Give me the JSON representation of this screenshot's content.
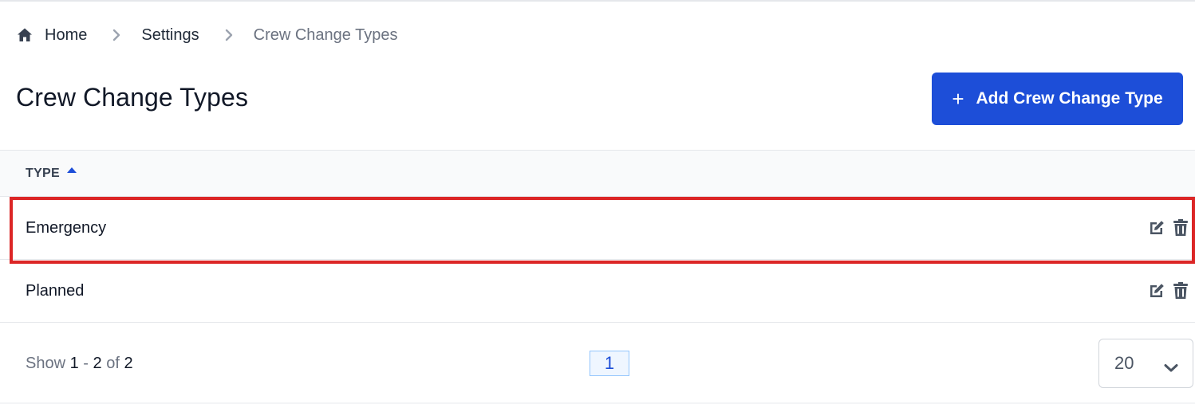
{
  "breadcrumb": {
    "items": [
      {
        "label": "Home",
        "icon": "home-icon"
      },
      {
        "label": "Settings"
      },
      {
        "label": "Crew Change Types"
      }
    ],
    "separator_icon": "chevron-right-icon"
  },
  "header": {
    "title": "Crew Change Types",
    "add_button": {
      "icon": "plus-icon",
      "label": "Add Crew Change Type"
    }
  },
  "table": {
    "columns": [
      {
        "label": "TYPE",
        "sort": "ascending",
        "sort_icon": "sort-up-icon"
      }
    ],
    "rows": [
      {
        "type": "Emergency",
        "actions": [
          "edit-icon",
          "delete-icon"
        ],
        "highlighted": true
      },
      {
        "type": "Planned",
        "actions": [
          "edit-icon",
          "delete-icon"
        ],
        "highlighted": false
      }
    ]
  },
  "pagination": {
    "show_label": "Show",
    "range_start": "1",
    "range_sep": "-",
    "range_end": "2",
    "of_label": "of",
    "total": "2",
    "current_page": "1",
    "per_page": "20"
  },
  "colors": {
    "primary": "#1d4ed8",
    "highlight": "#dc2626",
    "icon_gray": "#4b5563"
  }
}
